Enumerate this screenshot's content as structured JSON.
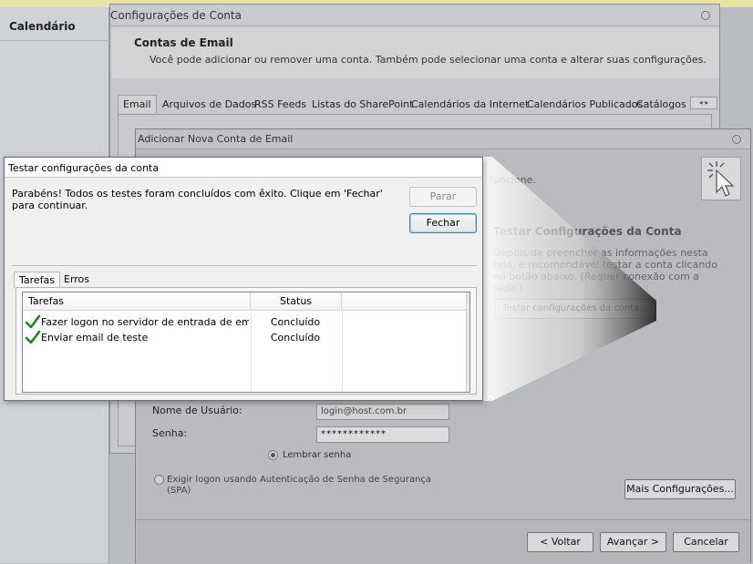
{
  "sidebar": {
    "title": "Calendário"
  },
  "account_settings": {
    "title": "Configurações de Conta",
    "heading": "Contas de Email",
    "description": "Você pode adicionar ou remover uma conta. Também pode selecionar uma conta e alterar suas configurações.",
    "tabs": [
      "Email",
      "Arquivos de Dados",
      "RSS Feeds",
      "Listas do SharePoint",
      "Calendários da Internet",
      "Calendários Publicados",
      "Catálogos"
    ]
  },
  "add_account": {
    "title": "Adicionar Nova Conta de Email",
    "truncated_text": "funcione.",
    "test_heading": "Testar Configurações da Conta",
    "test_description": "Depois de preencher as informações nesta tela, é recomendável testar a conta clicando no botão abaixo. (Requer conexão com a rede.)",
    "test_button": "Testar configurações da conta...",
    "username_label": "Nome de Usuário:",
    "username_value": "login@host.com.br",
    "password_label": "Senha:",
    "password_value": "************",
    "remember_label": "Lembrar senha",
    "spa_label": "Exigir logon usando Autenticação de Senha de Segurança (SPA)",
    "more_settings": "Mais Configurações...",
    "back": "< Voltar",
    "next": "Avançar >",
    "cancel": "Cancelar"
  },
  "test_dialog": {
    "title": "Testar configurações da conta",
    "message": "Parabéns! Todos os testes foram concluídos com êxito. Clique em 'Fechar' para continuar.",
    "stop_button": "Parar",
    "close_button": "Fechar",
    "tabs": [
      "Tarefas",
      "Erros"
    ],
    "columns": [
      "Tarefas",
      "Status"
    ],
    "rows": [
      {
        "task": "Fazer logon no servidor de entrada de email...",
        "status": "Concluído"
      },
      {
        "task": "Enviar email de teste",
        "status": "Concluído"
      }
    ]
  },
  "colors": {
    "check": "#1e8a1e",
    "default_button_border": "#3c7fb1"
  }
}
